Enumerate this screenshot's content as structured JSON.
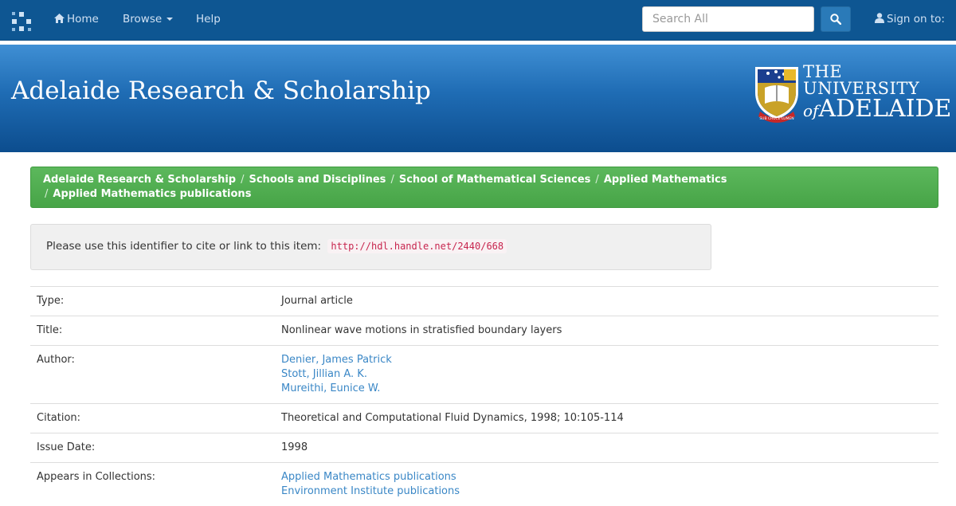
{
  "nav": {
    "home": "Home",
    "browse": "Browse",
    "help": "Help",
    "search_placeholder": "Search All",
    "signin": "Sign on to:"
  },
  "banner": {
    "title": "Adelaide Research & Scholarship",
    "uni_line1": "THE UNIVERSITY",
    "uni_of": "of",
    "uni_line2": "ADELAIDE"
  },
  "breadcrumb": [
    "Adelaide Research & Scholarship",
    "Schools and Disciplines",
    "School of Mathematical Sciences",
    "Applied Mathematics",
    "Applied Mathematics publications"
  ],
  "cite": {
    "text": "Please use this identifier to cite or link to this item:",
    "handle": "http://hdl.handle.net/2440/668"
  },
  "record": {
    "type_label": "Type:",
    "type_value": "Journal article",
    "title_label": "Title:",
    "title_value": "Nonlinear wave motions in stratisfied boundary layers",
    "author_label": "Author:",
    "authors": [
      "Denier, James Patrick",
      "Stott, Jillian A. K.",
      "Mureithi, Eunice W."
    ],
    "citation_label": "Citation:",
    "citation_value": "Theoretical and Computational Fluid Dynamics, 1998; 10:105-114",
    "date_label": "Issue Date:",
    "date_value": "1998",
    "collections_label": "Appears in Collections:",
    "collections": [
      "Applied Mathematics publications",
      "Environment Institute publications"
    ]
  },
  "icons": {
    "logo": "grid-logo-icon",
    "home": "home-icon",
    "search": "search-icon",
    "user": "user-icon"
  }
}
